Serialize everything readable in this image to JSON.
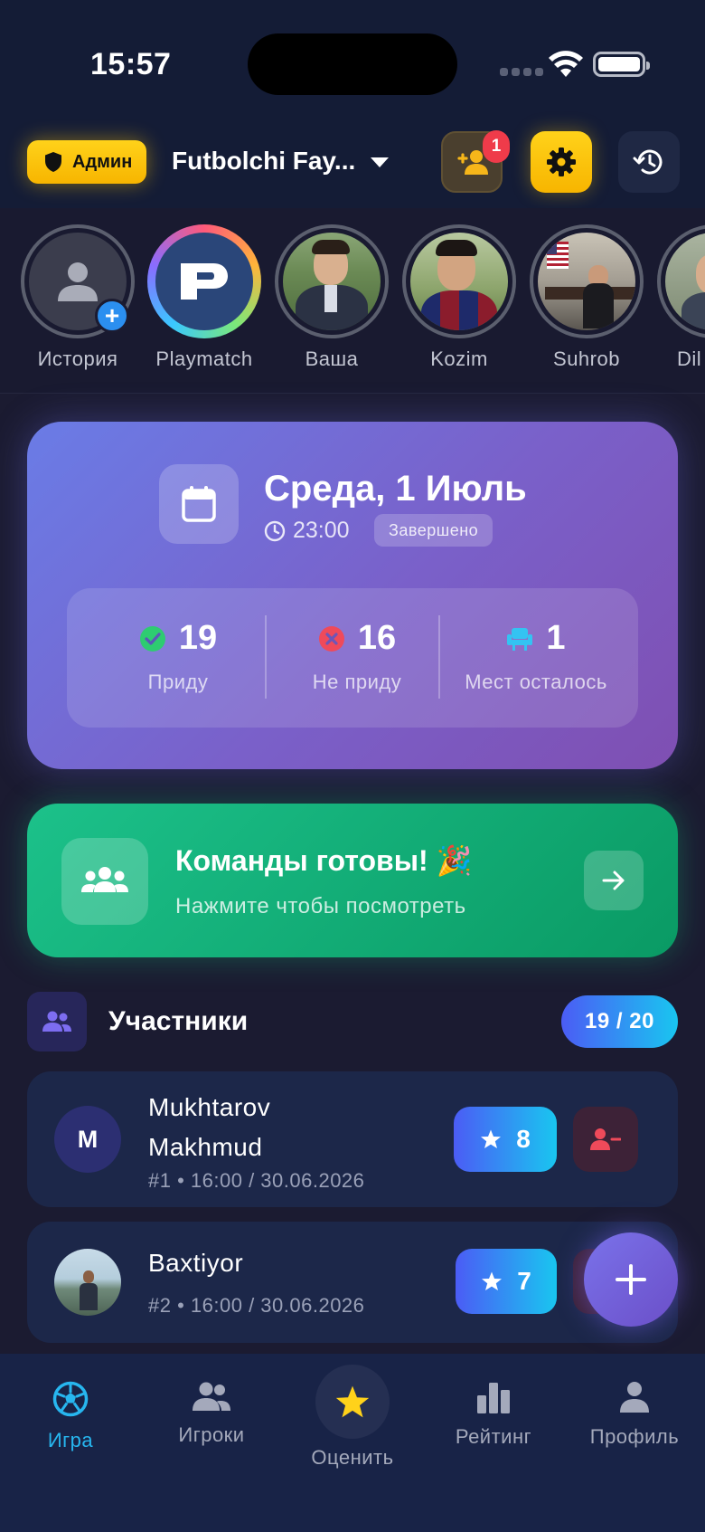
{
  "status_bar": {
    "time": "15:57"
  },
  "header": {
    "admin_label": "Админ",
    "group_title": "Futbolchi Fay...",
    "notification_count": "1"
  },
  "stories": [
    {
      "label": "История",
      "type": "add"
    },
    {
      "label": "Playmatch",
      "type": "brand"
    },
    {
      "label": "Ваша",
      "type": "photo"
    },
    {
      "label": "Kozim",
      "type": "photo"
    },
    {
      "label": "Suhrob",
      "type": "photo"
    },
    {
      "label": "Dil",
      "type": "photo"
    }
  ],
  "game": {
    "date_title": "Среда, 1 Июль",
    "time": "23:00",
    "status": "Завершено",
    "stats": {
      "coming_count": "19",
      "coming_label": "Приду",
      "not_coming_count": "16",
      "not_coming_label": "Не приду",
      "seats_left_count": "1",
      "seats_left_label": "Мест осталось"
    }
  },
  "teams_ready": {
    "title": "Команды готовы! 🎉",
    "subtitle": "Нажмите чтобы посмотреть"
  },
  "participants": {
    "title": "Участники",
    "count": "19 / 20",
    "rows": [
      {
        "initial": "M",
        "name_line1": "Mukhtarov",
        "name_line2": "Makhmud",
        "meta": "#1  •  16:00 / 30.06.2026",
        "rating": "8"
      },
      {
        "initial": "",
        "name_line1": "Baxtiyor",
        "name_line2": "",
        "meta": "#2  •  16:00 / 30.06.2026",
        "rating": "7"
      }
    ]
  },
  "bottom_nav": [
    {
      "label": "Игра",
      "icon": "soccer-ball-icon",
      "active": true
    },
    {
      "label": "Игроки",
      "icon": "users-icon",
      "active": false
    },
    {
      "label": "Оценить",
      "icon": "star-icon",
      "active": false
    },
    {
      "label": "Рейтинг",
      "icon": "bar-chart-icon",
      "active": false
    },
    {
      "label": "Профиль",
      "icon": "person-icon",
      "active": false
    }
  ],
  "colors": {
    "accent": "#27b6ef",
    "admin_yellow": "#ffc60a",
    "coming_green": "#2ecc71",
    "not_coming_red": "#ef4a5a",
    "card_purple": "#7a60c9",
    "teams_green": "#12ad76"
  }
}
